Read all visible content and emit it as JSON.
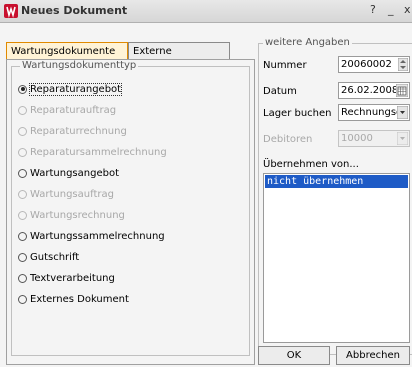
{
  "window": {
    "title": "Neues Dokument",
    "help": "?",
    "minimize": "_",
    "close": "x"
  },
  "tabs": [
    "Wartungsdokumente",
    "Externe Dokumente"
  ],
  "group_label": "Wartungsdokumenttyp",
  "options": [
    {
      "label": "Reparaturangebot",
      "checked": true,
      "enabled": true
    },
    {
      "label": "Reparaturauftrag",
      "checked": false,
      "enabled": false
    },
    {
      "label": "Reparaturrechnung",
      "checked": false,
      "enabled": false
    },
    {
      "label": "Reparatursammelrechnung",
      "checked": false,
      "enabled": false
    },
    {
      "label": "Wartungsangebot",
      "checked": false,
      "enabled": true
    },
    {
      "label": "Wartungsauftrag",
      "checked": false,
      "enabled": false
    },
    {
      "label": "Wartungsrechnung",
      "checked": false,
      "enabled": false
    },
    {
      "label": "Wartungssammelrechnung",
      "checked": false,
      "enabled": true
    },
    {
      "label": "Gutschrift",
      "checked": false,
      "enabled": true
    },
    {
      "label": "Textverarbeitung",
      "checked": false,
      "enabled": true
    },
    {
      "label": "Externes Dokument",
      "checked": false,
      "enabled": true
    }
  ],
  "details": {
    "label": "weitere Angaben",
    "nummer_label": "Nummer",
    "nummer_value": "20060002",
    "datum_label": "Datum",
    "datum_value": "26.02.2008",
    "lager_label": "Lager buchen",
    "lager_value": "Rechnungsd",
    "debitoren_label": "Debitoren",
    "debitoren_value": "10000",
    "uebernehmen_label": "Übernehmen von...",
    "uebernehmen_items": [
      "nicht übernehmen"
    ]
  },
  "buttons": {
    "ok": "OK",
    "cancel": "Abbrechen"
  }
}
